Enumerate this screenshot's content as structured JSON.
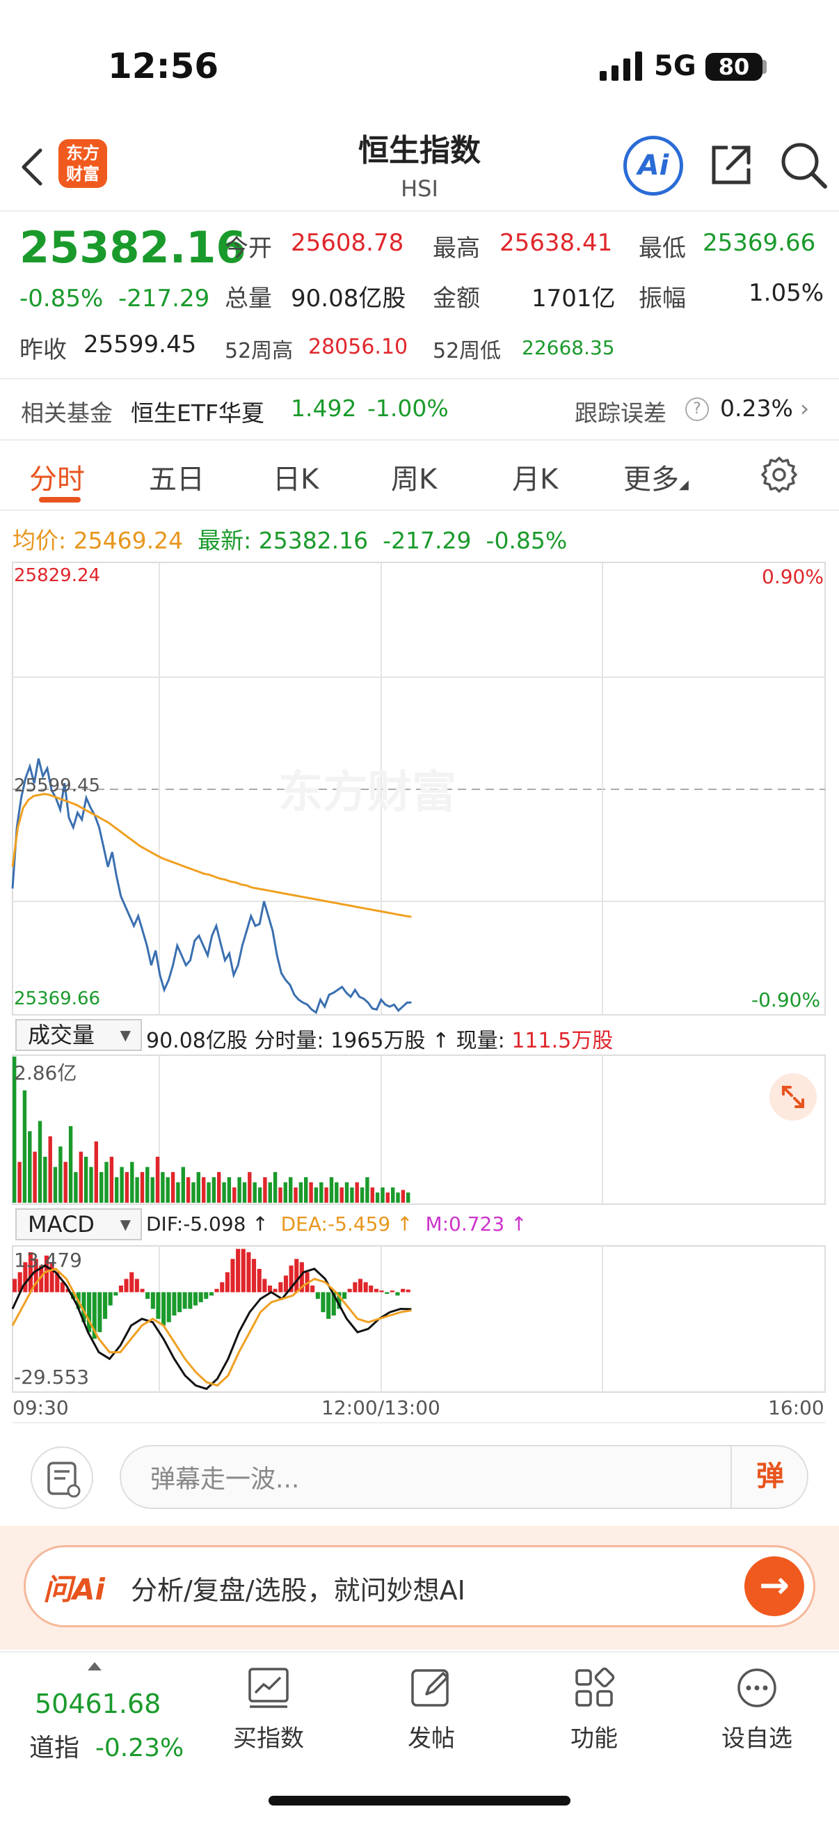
{
  "status": {
    "time": "12:56",
    "network": "5G",
    "battery": "80"
  },
  "nav": {
    "logo_line1": "东方",
    "logo_line2": "财富",
    "title": "恒生指数",
    "subtitle": "HSI",
    "ai_label": "Ai"
  },
  "quote": {
    "price": "25382.16",
    "change_pct": "-0.85%",
    "change_abs": "-217.29",
    "open_label": "今开",
    "open": "25608.78",
    "high_label": "最高",
    "high": "25638.41",
    "low_label": "最低",
    "low": "25369.66",
    "volume_label": "总量",
    "volume": "90.08亿股",
    "amount_label": "金额",
    "amount": "1701亿",
    "amplitude_label": "振幅",
    "amplitude": "1.05%",
    "prev_close_label": "昨收",
    "prev_close": "25599.45",
    "w52_high_label": "52周高",
    "w52_high": "28056.10",
    "w52_low_label": "52周低",
    "w52_low": "22668.35"
  },
  "fund": {
    "label": "相关基金",
    "name": "恒生ETF华夏",
    "price": "1.492",
    "change": "-1.00%",
    "tracking_label": "跟踪误差",
    "tracking": "0.23%",
    "help": "?"
  },
  "tabs": [
    {
      "label": "分时",
      "active": true
    },
    {
      "label": "五日"
    },
    {
      "label": "日K"
    },
    {
      "label": "周K"
    },
    {
      "label": "月K"
    },
    {
      "label": "更多"
    }
  ],
  "info": {
    "avg_label": "均价:",
    "avg": "25469.24",
    "latest_label": "最新:",
    "latest": "25382.16",
    "latest_chg": "-217.29",
    "latest_pct": "-0.85%"
  },
  "chart_data": {
    "type": "line",
    "price_max": "25829.24",
    "price_mid": "25599.45",
    "price_min": "25369.66",
    "pct_max": "0.90%",
    "pct_min": "-0.90%",
    "ylim": [
      25369.66,
      25829.24
    ],
    "series": [
      {
        "role": "price",
        "color": "#3a6fb0",
        "values": [
          25498,
          25560,
          25590,
          25610,
          25622,
          25605,
          25630,
          25612,
          25620,
          25598,
          25590,
          25578,
          25605,
          25570,
          25560,
          25575,
          25568,
          25590,
          25580,
          25572,
          25560,
          25540,
          25520,
          25535,
          25510,
          25490,
          25480,
          25470,
          25460,
          25470,
          25455,
          25440,
          25420,
          25435,
          25410,
          25395,
          25405,
          25420,
          25440,
          25430,
          25420,
          25425,
          25445,
          25450,
          25440,
          25430,
          25450,
          25460,
          25442,
          25425,
          25432,
          25410,
          25420,
          25440,
          25455,
          25470,
          25460,
          25462,
          25485,
          25470,
          25455,
          25430,
          25412,
          25405,
          25400,
          25390,
          25385,
          25382,
          25380,
          25375,
          25372,
          25385,
          25378,
          25390,
          25392,
          25395,
          25398,
          25392,
          25388,
          25395,
          25388,
          25386,
          25382,
          25376,
          25375,
          25385,
          25380,
          25378,
          25380,
          25374,
          25378,
          25382,
          25382.16
        ]
      },
      {
        "role": "average",
        "color": "#f0a020",
        "values": [
          25520,
          25560,
          25580,
          25588,
          25592,
          25593,
          25594,
          25593,
          25591,
          25589,
          25587,
          25585,
          25583,
          25580,
          25577,
          25574,
          25571,
          25568,
          25565,
          25561,
          25557,
          25553,
          25549,
          25545,
          25541,
          25538,
          25535,
          25532,
          25529,
          25527,
          25525,
          25523,
          25521,
          25519,
          25517,
          25515,
          25513,
          25512,
          25510,
          25508,
          25507,
          25505,
          25504,
          25502,
          25501,
          25499,
          25498,
          25497,
          25496,
          25495,
          25494,
          25493,
          25492,
          25491,
          25490,
          25489,
          25488,
          25487,
          25486,
          25485,
          25484,
          25483,
          25482,
          25481,
          25480,
          25479,
          25478,
          25477,
          25476,
          25475,
          25474,
          25473,
          25472,
          25471,
          25470,
          25469.24
        ]
      }
    ],
    "volume": {
      "selector": "成交量",
      "total": "90.08亿股",
      "minute_label": "分时量:",
      "minute": "1965万股",
      "current_label": "现量:",
      "current": "111.5万股",
      "max_label": "2.86亿",
      "ylim": [
        0,
        2.86
      ],
      "values": [
        2.86,
        0.8,
        2.2,
        1.4,
        1.0,
        1.6,
        0.9,
        1.3,
        0.7,
        1.1,
        0.8,
        1.5,
        0.6,
        1.0,
        0.9,
        0.7,
        1.2,
        0.6,
        0.8,
        0.9,
        0.5,
        0.7,
        0.6,
        0.8,
        0.5,
        0.6,
        0.7,
        0.5,
        0.9,
        0.6,
        0.5,
        0.6,
        0.4,
        0.7,
        0.5,
        0.4,
        0.6,
        0.5,
        0.4,
        0.5,
        0.6,
        0.4,
        0.5,
        0.3,
        0.5,
        0.4,
        0.6,
        0.4,
        0.3,
        0.5,
        0.4,
        0.6,
        0.3,
        0.4,
        0.5,
        0.3,
        0.4,
        0.5,
        0.4,
        0.3,
        0.4,
        0.3,
        0.5,
        0.4,
        0.3,
        0.4,
        0.3,
        0.4,
        0.3,
        0.5,
        0.3,
        0.2,
        0.3,
        0.2,
        0.3,
        0.2,
        0.25,
        0.2
      ]
    },
    "macd": {
      "selector": "MACD",
      "dif_label": "DIF:",
      "dif": "-5.098",
      "dea_label": "DEA:",
      "dea": "-5.459",
      "m_label": "M:",
      "m": "0.723",
      "max_label": "13.479",
      "min_label": "-29.553",
      "ylim": [
        -29.553,
        13.479
      ],
      "hist": [
        4,
        6,
        9,
        12,
        10,
        8,
        11,
        9,
        6,
        3,
        1,
        -2,
        -5,
        -9,
        -12,
        -14,
        -12,
        -8,
        -4,
        -1,
        2,
        4,
        6,
        4,
        1,
        -2,
        -5,
        -8,
        -10,
        -9,
        -7,
        -6,
        -5,
        -5,
        -4,
        -3,
        -2,
        -1,
        1,
        3,
        6,
        10,
        13,
        13,
        12,
        10,
        7,
        4,
        2,
        1,
        3,
        5,
        8,
        10,
        9,
        6,
        2,
        -2,
        -6,
        -8,
        -7,
        -5,
        -2,
        1,
        3,
        4,
        3,
        2,
        1,
        0.5,
        -0.5,
        0.5,
        -1,
        1,
        0.8
      ],
      "dif_line": [
        -5,
        2,
        6,
        8,
        6,
        2,
        -4,
        -12,
        -18,
        -20,
        -16,
        -10,
        -8,
        -9,
        -14,
        -20,
        -25,
        -28,
        -29,
        -26,
        -20,
        -12,
        -6,
        -2,
        0,
        -2,
        2,
        6,
        7,
        4,
        -2,
        -8,
        -12,
        -11,
        -8,
        -6,
        -5,
        -5.098
      ],
      "dea_line": [
        -10,
        -4,
        2,
        6,
        7,
        4,
        -2,
        -8,
        -14,
        -18,
        -18,
        -14,
        -10,
        -8,
        -10,
        -15,
        -20,
        -24,
        -27,
        -28,
        -25,
        -18,
        -12,
        -6,
        -3,
        -2,
        -1,
        2,
        4,
        3,
        0,
        -4,
        -8,
        -9,
        -8,
        -7,
        -6,
        -5.459
      ],
      "dif_color": "#111111",
      "dea_color": "#f0a020",
      "m_color": "#cc33cc"
    },
    "time_axis": [
      "09:30",
      "12:00/13:00",
      "16:00"
    ]
  },
  "comment": {
    "placeholder": "弹幕走一波...",
    "dan": "弹"
  },
  "ai_bar": {
    "brand": "问Ai",
    "text": "分析/复盘/选股，就问妙想AI"
  },
  "bottom": {
    "dj_value": "50461.68",
    "dj_label": "道指",
    "dj_change": "-0.23%",
    "items": [
      {
        "label": "买指数",
        "icon": "chart-icon"
      },
      {
        "label": "发帖",
        "icon": "edit-icon"
      },
      {
        "label": "功能",
        "icon": "grid-icon"
      },
      {
        "label": "设自选",
        "icon": "more-circle-icon"
      }
    ]
  },
  "colors": {
    "up": "#e0262b",
    "down": "#1a9a2b",
    "accent": "#e8541e",
    "avg": "#f0a020",
    "price_line": "#3a6fb0"
  }
}
